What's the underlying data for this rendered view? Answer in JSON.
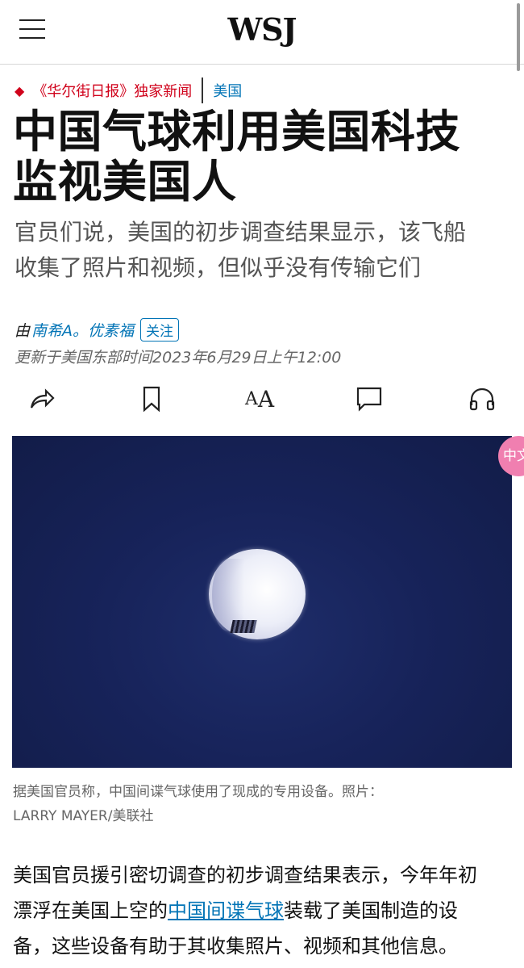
{
  "header": {
    "logo": "WSJ",
    "menu_icon": "hamburger-menu-icon"
  },
  "kicker": {
    "exclusive": "《华尔街日报》独家新闻",
    "section": "美国",
    "accent": "#d0021b",
    "link_color": "#0274b6"
  },
  "article": {
    "headline_line1": "中国气球利用美国科技",
    "headline_line2": "监视美国人",
    "subhead_line1": "官员们说，美国的初步调查结果显示，该飞船",
    "subhead_line2": "收集了照片和视频，但似乎没有传输它们",
    "byline_prefix": "由",
    "author": "南希A。优素福",
    "follow_label": "关注",
    "timestamp": "更新于美国东部时间2023年6月29日上午12:00"
  },
  "toolbar": {
    "share_icon": "share-icon",
    "bookmark_icon": "bookmark-icon",
    "text_size_label_big": "A",
    "text_size_label_small": "A",
    "comment_icon": "comment-icon",
    "listen_icon": "headphones-icon"
  },
  "photo": {
    "description_icon": "balloon-photo",
    "badge_text": "中文"
  },
  "caption": {
    "line1": "据美国官员称，中国间谍气球使用了现成的专用设备。照片：",
    "line2": "LARRY MAYER/美联社"
  },
  "body": {
    "line1": "美国官员援引密切调查的初步调查结果表示，今年年初",
    "line2_before": "漂浮在美国上空的",
    "line2_link": "中国间谍气球",
    "line2_after": "装载了美国制造的设",
    "line3": "备，这些设备有助于其收集照片、视频和其他信息。"
  }
}
